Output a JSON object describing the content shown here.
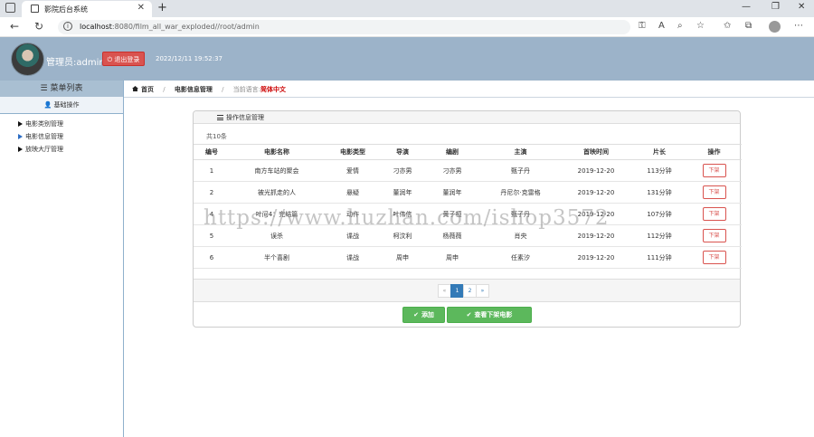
{
  "browser": {
    "tab_title": "影院后台系统",
    "tab_close": "✕",
    "new_tab": "+",
    "url_host": "localhost",
    "url_path": ":8080/film_all_war_exploded//root/admin",
    "win_min": "—",
    "win_max": "❐",
    "win_close": "✕",
    "nav_back": "←",
    "nav_refresh": "↻",
    "addr_info": "i"
  },
  "header": {
    "admin_label": "管理员:admin",
    "logout_label": "⏻ 退出登录",
    "time": "2022/12/11 19:52:37"
  },
  "sidebar": {
    "menu_title": "☰ 菜单列表",
    "menu_sub": "基础操作",
    "items": [
      {
        "label": "电影类别管理"
      },
      {
        "label": "电影信息管理"
      },
      {
        "label": "放映大厅管理"
      }
    ]
  },
  "breadcrumb": {
    "home": "首页",
    "current": "电影信息管理",
    "lang_label": "当前语言:",
    "lang_value": "简体中文"
  },
  "panel": {
    "title": "操作信息管理",
    "count": "共10条",
    "columns": [
      "编号",
      "电影名称",
      "电影类型",
      "导演",
      "编剧",
      "主演",
      "首映时间",
      "片长",
      "操作"
    ],
    "rows": [
      {
        "id": "1",
        "name": "南方车站的聚会",
        "type": "爱情",
        "director": "刁亦男",
        "writer": "刁亦男",
        "actor": "甄子丹",
        "date": "2019-12-20",
        "length": "113分钟",
        "op": "下架"
      },
      {
        "id": "2",
        "name": "被光抓走的人",
        "type": "悬疑",
        "director": "董润年",
        "writer": "董润年",
        "actor": "丹尼尔·克雷格",
        "date": "2019-12-20",
        "length": "131分钟",
        "op": "下架"
      },
      {
        "id": "4",
        "name": "叶问4：完结篇",
        "type": "动作",
        "director": "叶伟信",
        "writer": "黄子桓",
        "actor": "甄子丹",
        "date": "2019-12-20",
        "length": "107分钟",
        "op": "下架"
      },
      {
        "id": "5",
        "name": "误杀",
        "type": "谍战",
        "director": "柯汶利",
        "writer": "杨薇薇",
        "actor": "肖央",
        "date": "2019-12-20",
        "length": "112分钟",
        "op": "下架"
      },
      {
        "id": "6",
        "name": "半个喜剧",
        "type": "谍战",
        "director": "周申",
        "writer": "周申",
        "actor": "任素汐",
        "date": "2019-12-20",
        "length": "111分钟",
        "op": "下架"
      }
    ],
    "pager": {
      "prev": "«",
      "pages": [
        "1",
        "2"
      ],
      "next": "»"
    },
    "add_label": "添加",
    "view_offline_label": "查看下架电影"
  },
  "watermark": "https://www.huzhan.com/ishop3572"
}
